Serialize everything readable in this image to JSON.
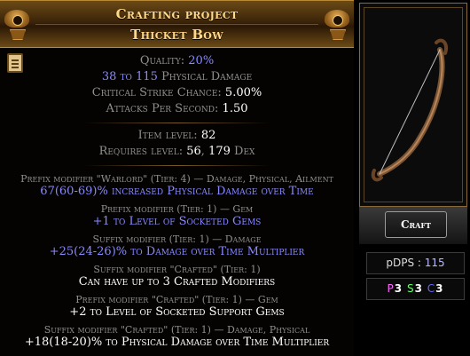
{
  "header": {
    "subtitle": "Crafting project",
    "title": "Thicket Bow"
  },
  "properties": {
    "quality_label": "Quality:",
    "quality_value": "20%",
    "physical_damage_value": "38 to 115",
    "physical_damage_label": "Physical Damage",
    "crit_label": "Critical Strike Chance:",
    "crit_value": "5.00%",
    "aps_label": "Attacks Per Second:",
    "aps_value": "1.50"
  },
  "requirements": {
    "item_level_label": "Item level:",
    "item_level_value": "82",
    "requires_label": "Requires level:",
    "requires_level_value": "56",
    "requires_dex_value": "179",
    "requires_dex_label": "Dex"
  },
  "modifiers": [
    {
      "header": "Prefix modifier \"Warlord\" (Tier: 4) — Damage, Physical, Ailment",
      "text": "67(60-69)% increased Physical Damage over Time"
    },
    {
      "header": "Prefix modifier (Tier: 1) — Gem",
      "text": "+1 to Level of Socketed Gems"
    },
    {
      "header": "Suffix modifier (Tier: 1) — Damage",
      "text": "+25(24-26)% to Damage over Time Multiplier"
    },
    {
      "header": "Suffix modifier \"Crafted\" (Tier: 1)",
      "text": "Can have up to 3 Crafted Modifiers"
    },
    {
      "header": "Prefix modifier \"Crafted\" (Tier: 1) — Gem",
      "text": "+2 to Level of Socketed Support Gems"
    },
    {
      "header": "Suffix modifier \"Crafted\" (Tier: 1) — Damage, Physical",
      "text": "+18(18-20)% to Physical Damage over Time Multiplier"
    }
  ],
  "side": {
    "craft_label": "Craft",
    "pdps_label": "pDPS :",
    "pdps_value": "115",
    "sockets": {
      "p_label": "P",
      "p_value": "3",
      "s_label": "S",
      "s_value": "3",
      "c_label": "C",
      "c_value": "3"
    }
  },
  "colors": {
    "header_gold": "#ffd88a",
    "magic_blue": "#8888ff",
    "text_grey": "#8f8f8f",
    "socket_p": "#ff66ff",
    "socket_s": "#66ff66",
    "socket_c": "#6666ff"
  },
  "icons": {
    "left_emblem": "winged-emblem-icon",
    "right_emblem": "winged-emblem-icon",
    "note": "clipboard-icon",
    "preview": "bow-icon"
  }
}
